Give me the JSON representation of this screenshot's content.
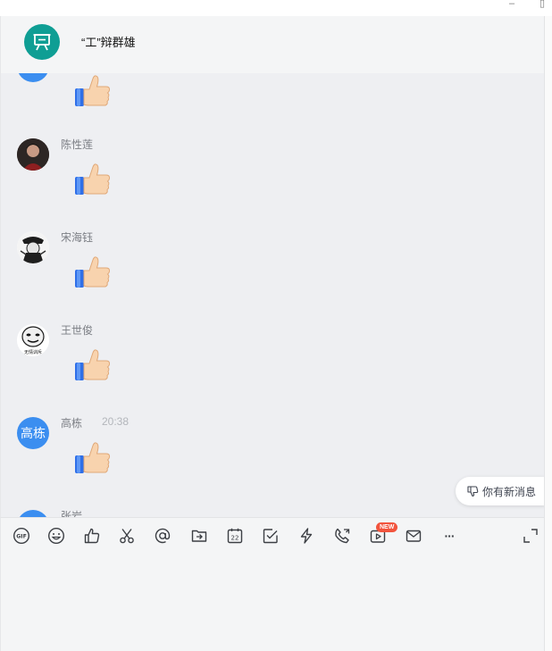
{
  "window": {
    "minimize_glyph": "–",
    "maximize_glyph": "▯"
  },
  "header": {
    "title": "“工”辩群雄",
    "avatar_icon": "presentation-board-icon",
    "avatar_color": "#0f9e94"
  },
  "messages": [
    {
      "sender": "陈性莲",
      "content": "thumbs-up-sticker",
      "avatar": "photo"
    },
    {
      "sender": "宋海钰",
      "content": "thumbs-up-sticker",
      "avatar": "photo"
    },
    {
      "sender": "王世俊",
      "content": "thumbs-up-sticker",
      "avatar": "photo",
      "avatar_caption": "无情训斥"
    },
    {
      "sender": "高栋",
      "time": "20:38",
      "content": "thumbs-up-sticker",
      "avatar_text": "高栋",
      "avatar_color": "#3b8ef0"
    },
    {
      "sender": "张岩",
      "avatar_color": "#3b8ef0"
    }
  ],
  "new_message_hint": "你有新消息",
  "toolbar": {
    "items": [
      "gif-icon",
      "emoji-icon",
      "thumbs-up-icon",
      "scissors-icon",
      "at-icon",
      "folder-send-icon",
      "calendar-icon",
      "checkbox-icon",
      "lightning-icon",
      "voice-call-icon",
      "live-video-icon",
      "mail-icon",
      "more-icon",
      "expand-icon"
    ],
    "gif_label": "GIF",
    "calendar_day": "22",
    "new_badge": "NEW",
    "more_glyph": "···"
  },
  "colors": {
    "accent_blue": "#3b8ef0",
    "new_badge": "#f2543d",
    "chat_bg": "#eeeff2"
  }
}
